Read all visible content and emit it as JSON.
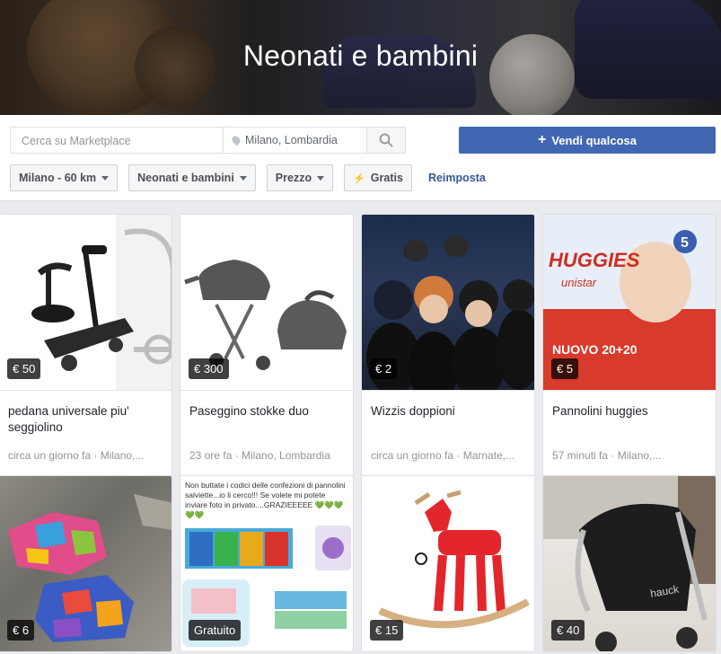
{
  "banner": {
    "title": "Neonati e bambini"
  },
  "search": {
    "placeholder": "Cerca su Marketplace",
    "location": "Milano, Lombardia"
  },
  "sell_button": {
    "label": "Vendi qualcosa"
  },
  "filters": [
    {
      "label": "Milano - 60 km"
    },
    {
      "label": "Neonati e bambini"
    },
    {
      "label": "Prezzo"
    },
    {
      "label": "Gratis"
    }
  ],
  "reset_label": "Reimposta",
  "listings": [
    {
      "price": "€ 50",
      "title": "pedana universale piu' seggiolino",
      "meta": "circa un giorno fa · Milano,..."
    },
    {
      "price": "€ 300",
      "title": "Paseggino stokke duo",
      "meta": "23 ore fa · Milano, Lombardia"
    },
    {
      "price": "€ 2",
      "title": "Wizzis doppioni",
      "meta": "circa un giorno fa · Marnate,..."
    },
    {
      "price": "€ 5",
      "title": "Pannolini huggies",
      "meta": "57 minuti fa · Milano,..."
    },
    {
      "price": "€ 6",
      "title": "",
      "meta": ""
    },
    {
      "price": "Gratuito",
      "title": "",
      "meta": "",
      "photo_text": "Non buttate i codici delle confezioni di pannolini salviette...io li cerco!!! Se volete mi potete inviare foto in privato....GRAZIEEEEE 💚💚💚💚💚"
    },
    {
      "price": "€ 15",
      "title": "",
      "meta": ""
    },
    {
      "price": "€ 40",
      "title": "",
      "meta": ""
    }
  ],
  "photo_labels": {
    "huggies_brand": "HUGGIES",
    "huggies_line": "unistar",
    "huggies_size": "5",
    "huggies_promo": "NUOVO 20+20",
    "stroller_brand": "hauck"
  }
}
